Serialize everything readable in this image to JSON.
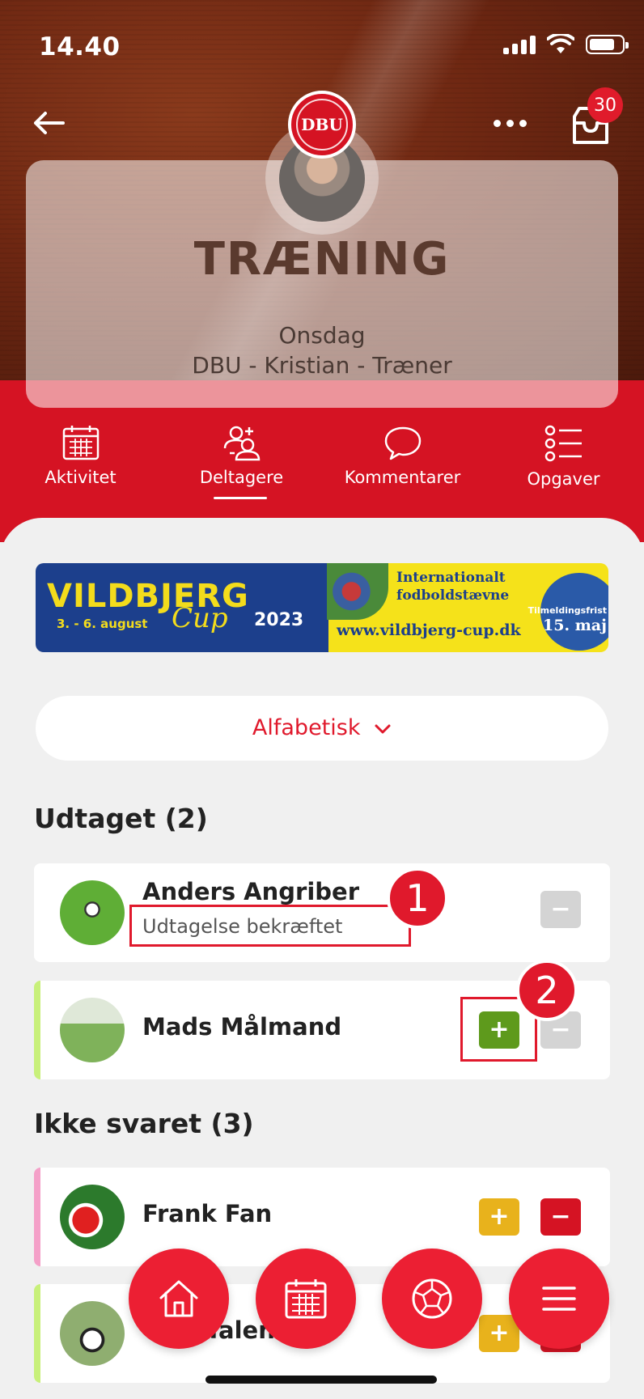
{
  "status_bar": {
    "time": "14.40"
  },
  "header": {
    "badge_count": "30",
    "logo_text": "DBU",
    "title": "TRÆNING",
    "day": "Onsdag",
    "subtitle": "DBU - Kristian - Træner"
  },
  "tabs": [
    {
      "label": "Aktivitet",
      "icon": "calendar-icon"
    },
    {
      "label": "Deltagere",
      "icon": "participants-icon",
      "active": true
    },
    {
      "label": "Kommentarer",
      "icon": "speech-bubble-icon"
    },
    {
      "label": "Opgaver",
      "icon": "task-list-icon"
    }
  ],
  "banner": {
    "brand": "VILDBJERG",
    "cup": "Cup",
    "year": "2023",
    "dates": "3. - 6. august",
    "headline_line1": "Internationalt",
    "headline_line2": "fodboldstævne",
    "url": "www.vildbjerg-cup.dk",
    "deadline_label": "Tilmeldingsfrist",
    "deadline_date": "15. maj"
  },
  "sort": {
    "label": "Alfabetisk"
  },
  "sections": {
    "selected": {
      "title": "Udtaget (2)",
      "rows": [
        {
          "name": "Anders Angriber",
          "status": "Udtagelse bekræftet"
        },
        {
          "name": "Mads Målmand"
        }
      ]
    },
    "no_answer": {
      "title": "Ikke svaret (3)",
      "rows": [
        {
          "name": "Frank Fan"
        },
        {
          "name": "Talent"
        }
      ]
    }
  },
  "button_glyphs": {
    "plus": "+",
    "minus": "−"
  },
  "annotations": {
    "marker1": "1",
    "marker2": "2"
  },
  "bottom_nav": [
    "home-icon",
    "calendar-icon",
    "football-icon",
    "menu-icon"
  ],
  "colors": {
    "brand_red": "#d51323",
    "accept_green": "#5e9a1c",
    "pending_yellow": "#e8b21c"
  }
}
